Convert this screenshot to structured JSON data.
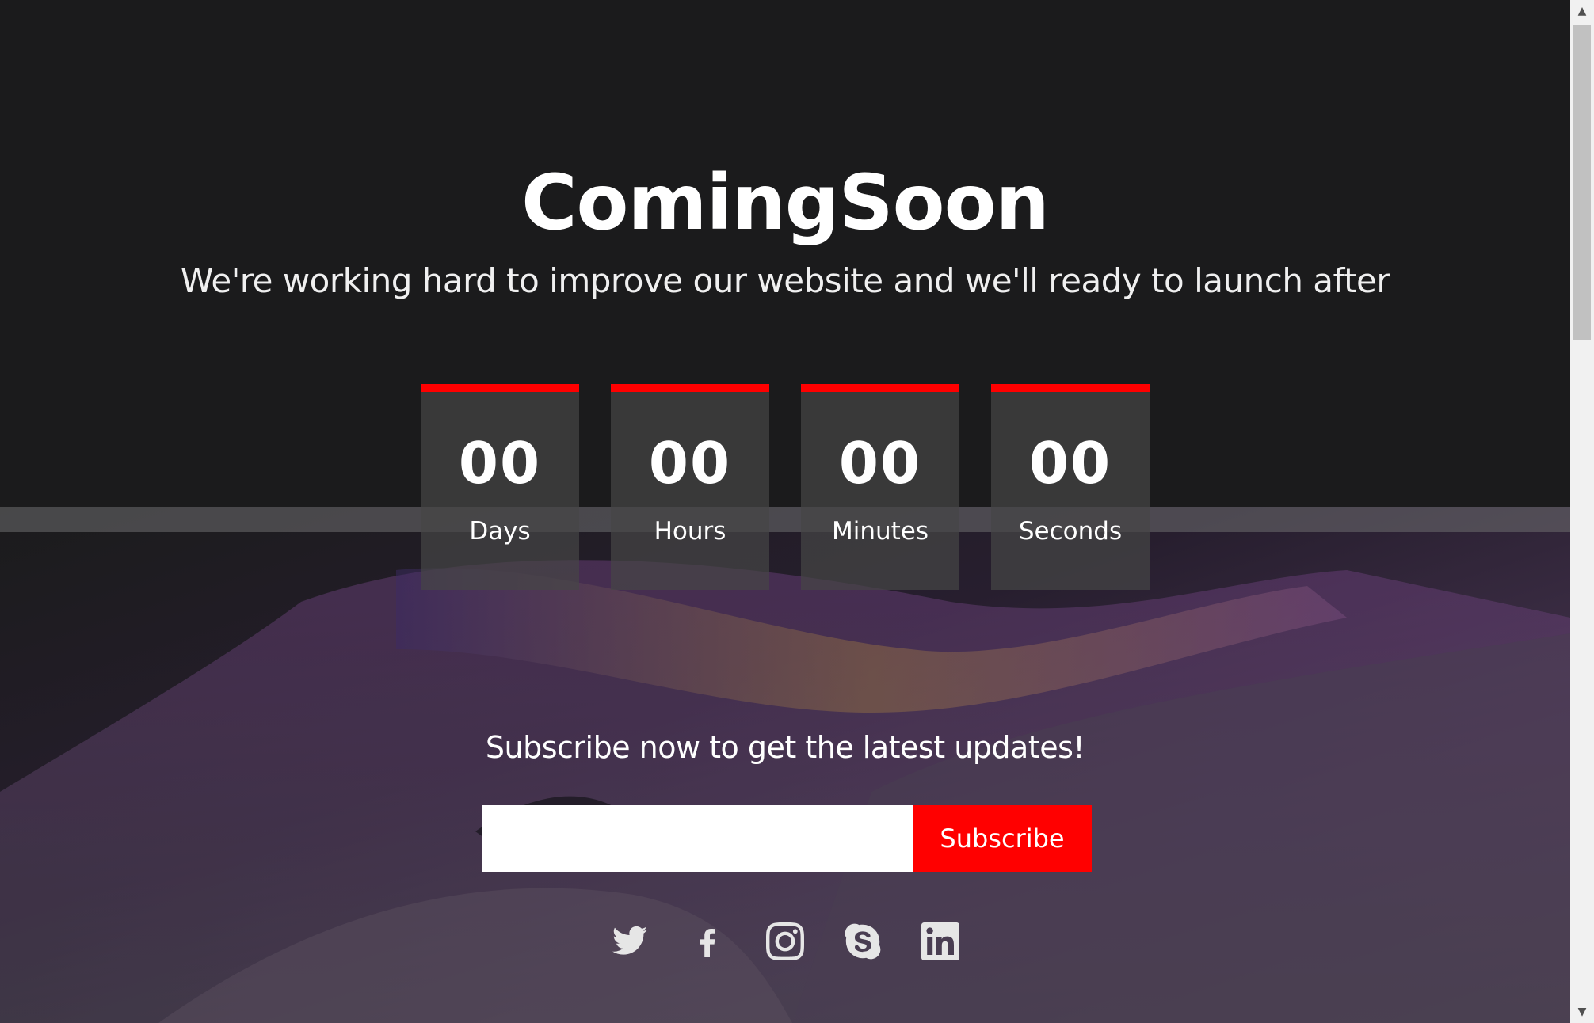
{
  "page": {
    "title": "ComingSoon",
    "subtitle": "We're working hard to improve our website and we'll ready to launch after"
  },
  "countdown": [
    {
      "value": "00",
      "label": "Days"
    },
    {
      "value": "00",
      "label": "Hours"
    },
    {
      "value": "00",
      "label": "Minutes"
    },
    {
      "value": "00",
      "label": "Seconds"
    }
  ],
  "subscribe": {
    "heading": "Subscribe now to get the latest updates!",
    "email_value": "",
    "email_placeholder": "",
    "button_label": "Subscribe"
  },
  "socials": [
    {
      "icon": "twitter-icon"
    },
    {
      "icon": "facebook-icon"
    },
    {
      "icon": "instagram-icon"
    },
    {
      "icon": "skype-icon"
    },
    {
      "icon": "linkedin-icon"
    }
  ],
  "colors": {
    "background": "#1b1b1c",
    "accent": "#ff0000",
    "text": "#ffffff"
  }
}
